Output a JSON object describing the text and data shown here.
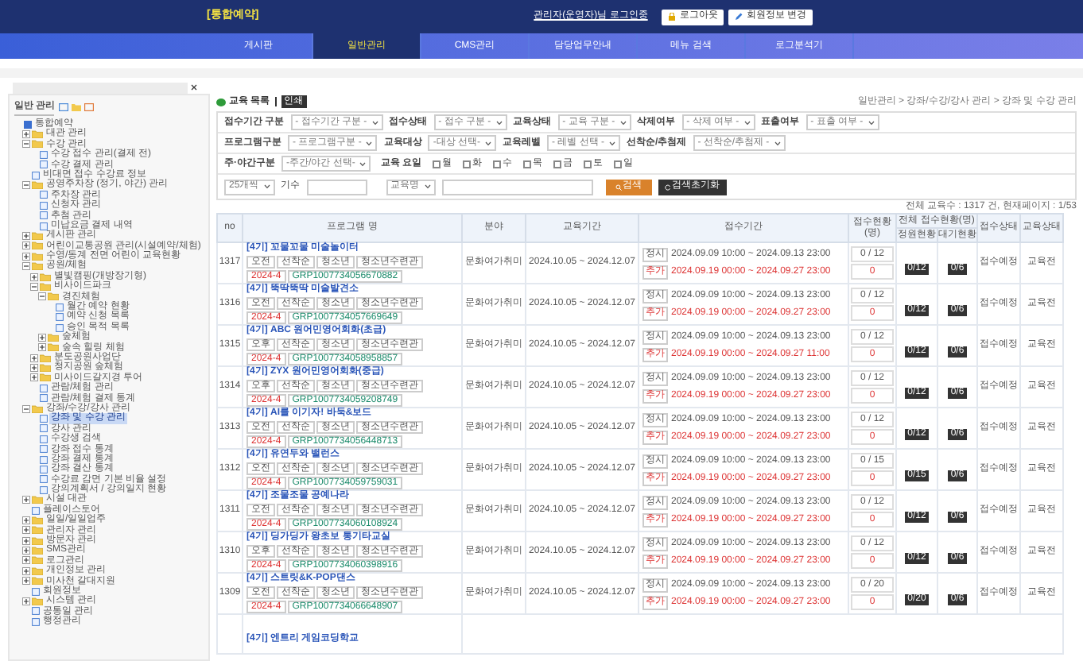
{
  "header": {
    "title": "[통합예약]",
    "user": "관리자(운영자)님 로그인중",
    "buttons": [
      {
        "kind": "logout",
        "label": "로그아웃"
      },
      {
        "kind": "profile",
        "label": "회원정보 변경"
      }
    ]
  },
  "nav": [
    {
      "label": "게시판",
      "selected": false
    },
    {
      "label": "일반관리",
      "selected": true
    },
    {
      "label": "CMS관리",
      "selected": false
    },
    {
      "label": "담당업무안내",
      "selected": false
    },
    {
      "label": "메뉴 검색",
      "selected": false
    },
    {
      "label": "로그분석기",
      "selected": false
    }
  ],
  "sidebar": {
    "title": "일반 관리",
    "tree": [
      {
        "label": "통합예약",
        "kind": "root",
        "expanded": true,
        "children": [
          {
            "label": "대관 관리",
            "kind": "folder",
            "expanded": false
          },
          {
            "label": "수강 관리",
            "kind": "folder",
            "expanded": true,
            "children": [
              {
                "label": "수강 접수 관리(결제 전)",
                "kind": "page"
              },
              {
                "label": "수강 결제 관리",
                "kind": "page"
              }
            ]
          },
          {
            "label": "비대면 접수 수강료 정보",
            "kind": "page"
          },
          {
            "label": "공영주차장 (정기, 야간) 관리",
            "kind": "folder",
            "expanded": true,
            "children": [
              {
                "label": "주차장 관리",
                "kind": "page"
              },
              {
                "label": "신청자 관리",
                "kind": "page"
              },
              {
                "label": "추첨 관리",
                "kind": "page"
              },
              {
                "label": "미납요금 결제 내역",
                "kind": "page"
              }
            ]
          },
          {
            "label": "게시판 관리",
            "kind": "folder",
            "expanded": false
          },
          {
            "label": "어린이교통공원 관리(시설예약/체험)",
            "kind": "folder",
            "expanded": false
          },
          {
            "label": "수영/동계 전면 어린이 교육현황",
            "kind": "folder",
            "expanded": false
          },
          {
            "label": "공원/체험",
            "kind": "folder",
            "expanded": true,
            "children": [
              {
                "label": "별빛캠핑(개방장기형)",
                "kind": "folder",
                "expanded": false
              },
              {
                "label": "비사이드파크",
                "kind": "folder",
                "expanded": true,
                "children": [
                  {
                    "label": "경진체험",
                    "kind": "folder",
                    "expanded": true,
                    "children": [
                      {
                        "label": "월간 예약 현황",
                        "kind": "page"
                      },
                      {
                        "label": "예약 신청 목록",
                        "kind": "page"
                      },
                      {
                        "label": "승인 목적 목록",
                        "kind": "page"
                      }
                    ]
                  },
                  {
                    "label": "숲체험",
                    "kind": "folder",
                    "expanded": false
                  },
                  {
                    "label": "숲속 힐링 체험",
                    "kind": "folder",
                    "expanded": false
                  }
                ]
              },
              {
                "label": "분도공원사업단",
                "kind": "folder",
                "expanded": false
              },
              {
                "label": "청지공원 숲체험",
                "kind": "folder",
                "expanded": false
              },
              {
                "label": "미사이드갈지경 투어",
                "kind": "folder",
                "expanded": false
              },
              {
                "label": "관람/체험 관리",
                "kind": "page"
              },
              {
                "label": "관람/체험 결제 통계",
                "kind": "page"
              }
            ]
          },
          {
            "label": "강좌/수강/강사 관리",
            "kind": "folder",
            "expanded": true,
            "children": [
              {
                "label": "강좌 및 수강 관리",
                "kind": "page",
                "selected": true
              },
              {
                "label": "강사 관리",
                "kind": "page",
                "selected": false
              },
              {
                "label": "수강생 검색",
                "kind": "page",
                "selected": false
              },
              {
                "label": "강좌 접수 통계",
                "kind": "page",
                "selected": false
              },
              {
                "label": "강좌 결제 통계",
                "kind": "page",
                "selected": false
              },
              {
                "label": "강좌 결산 통계",
                "kind": "page",
                "selected": false
              },
              {
                "label": "수강료 감면 기본 비율 설정",
                "kind": "page",
                "selected": false
              },
              {
                "label": "강의계획서 / 강의일지 현황",
                "kind": "page",
                "selected": false
              }
            ]
          },
          {
            "label": "시설 대관",
            "kind": "folder",
            "expanded": false
          },
          {
            "label": "플레이스토어",
            "kind": "page"
          },
          {
            "label": "일일/일일업주",
            "kind": "folder",
            "expanded": false
          },
          {
            "label": "관리자 관리",
            "kind": "folder",
            "expanded": false
          },
          {
            "label": "방문자 관리",
            "kind": "folder",
            "expanded": false
          },
          {
            "label": "SMS관리",
            "kind": "folder",
            "expanded": false
          },
          {
            "label": "로그관리",
            "kind": "folder",
            "expanded": false
          },
          {
            "label": "개인정보 관리",
            "kind": "folder",
            "expanded": false
          },
          {
            "label": "미사천 갈대지원",
            "kind": "folder",
            "expanded": false
          },
          {
            "label": "회원정보",
            "kind": "page"
          },
          {
            "label": "시스템 관리",
            "kind": "folder",
            "expanded": false
          },
          {
            "label": "공통일 관리",
            "kind": "page"
          },
          {
            "label": "행정관리",
            "kind": "page"
          }
        ]
      }
    ]
  },
  "page": {
    "title": "교육 목록",
    "print_button": "인쇄",
    "breadcrumb": "일반관리 > 강좌/수강/강사 관리 > 강좌 및 수강 관리"
  },
  "filters": [
    [
      {
        "label": "접수기간 구분",
        "value": "- 접수기간 구분 -"
      },
      {
        "label": "접수상태",
        "value": "- 접수 구분 -"
      },
      {
        "label": "교육상태",
        "value": "- 교육 구분 -"
      },
      {
        "label": "삭제여부",
        "value": "- 삭제 여부 -"
      },
      {
        "label": "표출여부",
        "value": "- 표출 여부 -"
      }
    ],
    [
      {
        "label": "프로그램구분",
        "value": "- 프로그램구분 -"
      },
      {
        "label": "교육대상",
        "value": "-대상 선택-"
      },
      {
        "label": "교육레벨",
        "value": "- 레벨 선택 -"
      },
      {
        "label": "선착순/추첨제",
        "value": "- 선착순/추첨제 -"
      }
    ],
    [
      {
        "label": "주·야간구분",
        "value": "-주간/야간 선택-"
      }
    ]
  ],
  "weekdays": {
    "label": "교육 요일",
    "days": [
      {
        "label": "월",
        "checked": false
      },
      {
        "label": "화",
        "checked": false
      },
      {
        "label": "수",
        "checked": false
      },
      {
        "label": "목",
        "checked": false
      },
      {
        "label": "금",
        "checked": false
      },
      {
        "label": "토",
        "checked": false
      },
      {
        "label": "일",
        "checked": false
      }
    ]
  },
  "search": {
    "page_size": "25개씩",
    "term_label": "기수",
    "field": "교육명",
    "search_button": "검색",
    "reset_button": "검색초기화"
  },
  "summary": "전체 교육수 : 1317 건, 현재페이지 : 1/53",
  "table": {
    "columns": [
      "no",
      "프로그램 명",
      "분야",
      "교육기간",
      "접수기간",
      "접수현황(명)",
      "전체 접수현황(명)",
      "접수상태",
      "교육상태"
    ],
    "subcolumns": [
      "정원현황",
      "대기현황"
    ],
    "rows": [
      {
        "no": "1317",
        "title": "[4기] 꼬물꼬물 미술놀이터",
        "tags": [
          "오전",
          "선착순",
          "청소년",
          "청소년수련관"
        ],
        "term": "2024-4",
        "code": "GRP1007734056670882",
        "field": "문화여가취미",
        "period": "2024.10.05 ~ 2024.12.07",
        "apply": [
          {
            "kind": "regular",
            "label": "정시",
            "dates": "2024.09.09 10:00 ~ 2024.09.13 23:00"
          },
          {
            "kind": "extra",
            "label": "추가",
            "dates": "2024.09.19 00:00 ~ 2024.09.27 23:00"
          }
        ],
        "count": "0 / 12",
        "extra_count": "0",
        "capacity": "0/12",
        "waiting": "0/6",
        "apply_status": "접수예정",
        "edu_status": "교육전"
      },
      {
        "no": "1316",
        "title": "[4기] 뚝딱뚝딱 미술발견소",
        "tags": [
          "오전",
          "선착순",
          "청소년",
          "청소년수련관"
        ],
        "term": "2024-4",
        "code": "GRP1007734057669649",
        "field": "문화여가취미",
        "period": "2024.10.05 ~ 2024.12.07",
        "apply": [
          {
            "kind": "regular",
            "label": "정시",
            "dates": "2024.09.09 10:00 ~ 2024.09.13 23:00"
          },
          {
            "kind": "extra",
            "label": "추가",
            "dates": "2024.09.19 00:00 ~ 2024.09.27 23:00"
          }
        ],
        "count": "0 / 12",
        "extra_count": "0",
        "capacity": "0/12",
        "waiting": "0/6",
        "apply_status": "접수예정",
        "edu_status": "교육전"
      },
      {
        "no": "1315",
        "title": "[4기] ABC 원어민영어회화(초급)",
        "tags": [
          "오후",
          "선착순",
          "청소년",
          "청소년수련관"
        ],
        "term": "2024-4",
        "code": "GRP1007734058958857",
        "field": "문화여가취미",
        "period": "2024.10.05 ~ 2024.12.07",
        "apply": [
          {
            "kind": "regular",
            "label": "정시",
            "dates": "2024.09.09 10:00 ~ 2024.09.13 23:00"
          },
          {
            "kind": "extra",
            "label": "추가",
            "dates": "2024.09.19 00:00 ~ 2024.09.27 11:00"
          }
        ],
        "count": "0 / 12",
        "extra_count": "0",
        "capacity": "0/12",
        "waiting": "0/6",
        "apply_status": "접수예정",
        "edu_status": "교육전"
      },
      {
        "no": "1314",
        "title": "[4기] ZYX 원어민영어회화(중급)",
        "tags": [
          "오후",
          "선착순",
          "청소년",
          "청소년수련관"
        ],
        "term": "2024-4",
        "code": "GRP1007734059208749",
        "field": "문화여가취미",
        "period": "2024.10.05 ~ 2024.12.07",
        "apply": [
          {
            "kind": "regular",
            "label": "정시",
            "dates": "2024.09.09 10:00 ~ 2024.09.13 23:00"
          },
          {
            "kind": "extra",
            "label": "추가",
            "dates": "2024.09.19 00:00 ~ 2024.09.27 23:00"
          }
        ],
        "count": "0 / 12",
        "extra_count": "0",
        "capacity": "0/12",
        "waiting": "0/6",
        "apply_status": "접수예정",
        "edu_status": "교육전"
      },
      {
        "no": "1313",
        "title": "[4기] AI를 이기자! 바둑&보드",
        "tags": [
          "오전",
          "선착순",
          "청소년",
          "청소년수련관"
        ],
        "term": "2024-4",
        "code": "GRP1007734056448713",
        "field": "문화여가취미",
        "period": "2024.10.05 ~ 2024.12.07",
        "apply": [
          {
            "kind": "regular",
            "label": "정시",
            "dates": "2024.09.09 10:00 ~ 2024.09.13 23:00"
          },
          {
            "kind": "extra",
            "label": "추가",
            "dates": "2024.09.19 00:00 ~ 2024.09.27 23:00"
          }
        ],
        "count": "0 / 12",
        "extra_count": "0",
        "capacity": "0/12",
        "waiting": "0/6",
        "apply_status": "접수예정",
        "edu_status": "교육전"
      },
      {
        "no": "1312",
        "title": "[4기] 유연두와 밸런스",
        "tags": [
          "오전",
          "선착순",
          "청소년",
          "청소년수련관"
        ],
        "term": "2024-4",
        "code": "GRP1007734059759031",
        "field": "문화여가취미",
        "period": "2024.10.05 ~ 2024.12.07",
        "apply": [
          {
            "kind": "regular",
            "label": "정시",
            "dates": "2024.09.09 10:00 ~ 2024.09.13 23:00"
          },
          {
            "kind": "extra",
            "label": "추가",
            "dates": "2024.09.19 00:00 ~ 2024.09.27 23:00"
          }
        ],
        "count": "0 / 15",
        "extra_count": "0",
        "capacity": "0/15",
        "waiting": "0/6",
        "apply_status": "접수예정",
        "edu_status": "교육전"
      },
      {
        "no": "1311",
        "title": "[4기] 조물조물 공예나라",
        "tags": [
          "오전",
          "선착순",
          "청소년",
          "청소년수련관"
        ],
        "term": "2024-4",
        "code": "GRP1007734060108924",
        "field": "문화여가취미",
        "period": "2024.10.05 ~ 2024.12.07",
        "apply": [
          {
            "kind": "regular",
            "label": "정시",
            "dates": "2024.09.09 10:00 ~ 2024.09.13 23:00"
          },
          {
            "kind": "extra",
            "label": "추가",
            "dates": "2024.09.19 00:00 ~ 2024.09.27 23:00"
          }
        ],
        "count": "0 / 12",
        "extra_count": "0",
        "capacity": "0/12",
        "waiting": "0/6",
        "apply_status": "접수예정",
        "edu_status": "교육전"
      },
      {
        "no": "1310",
        "title": "[4기] 딩가딩가 왕초보 통기타교실",
        "tags": [
          "오후",
          "선착순",
          "청소년",
          "청소년수련관"
        ],
        "term": "2024-4",
        "code": "GRP1007734060398916",
        "field": "문화여가취미",
        "period": "2024.10.05 ~ 2024.12.07",
        "apply": [
          {
            "kind": "regular",
            "label": "정시",
            "dates": "2024.09.09 10:00 ~ 2024.09.13 23:00"
          },
          {
            "kind": "extra",
            "label": "추가",
            "dates": "2024.09.19 00:00 ~ 2024.09.27 23:00"
          }
        ],
        "count": "0 / 12",
        "extra_count": "0",
        "capacity": "0/12",
        "waiting": "0/6",
        "apply_status": "접수예정",
        "edu_status": "교육전"
      },
      {
        "no": "1309",
        "title": "[4기] 스트릿&K-POP댄스",
        "tags": [
          "오전",
          "선착순",
          "청소년",
          "청소년수련관"
        ],
        "term": "2024-4",
        "code": "GRP1007734066648907",
        "field": "문화여가취미",
        "period": "2024.10.05 ~ 2024.12.07",
        "apply": [
          {
            "kind": "regular",
            "label": "정시",
            "dates": "2024.09.09 10:00 ~ 2024.09.13 23:00"
          },
          {
            "kind": "extra",
            "label": "추가",
            "dates": "2024.09.19 00:00 ~ 2024.09.27 23:00"
          }
        ],
        "count": "0 / 20",
        "extra_count": "0",
        "capacity": "0/20",
        "waiting": "0/6",
        "apply_status": "접수예정",
        "edu_status": "교육전"
      }
    ],
    "cut_row": {
      "title": "[4기] 엔트리 게임코딩학교"
    }
  }
}
